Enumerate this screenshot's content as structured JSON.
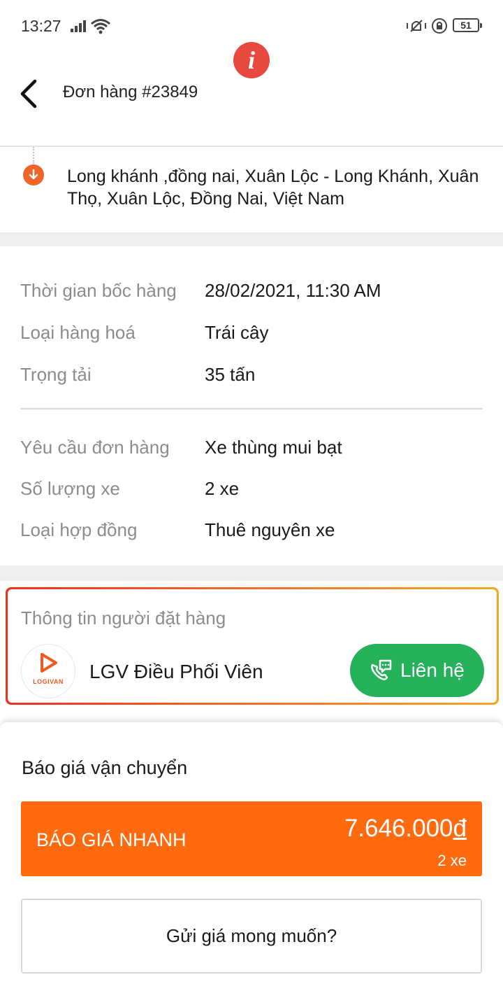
{
  "status_bar": {
    "time": "13:27",
    "battery": "51"
  },
  "header": {
    "title": "Đơn hàng #23849"
  },
  "route": {
    "dropoff_address": "Long khánh ,đồng nai, Xuân Lộc - Long Khánh, Xuân Thọ, Xuân Lộc, Đồng Nai, Việt Nam"
  },
  "details": [
    {
      "label": "Thời gian bốc hàng",
      "value": "28/02/2021, 11:30 AM"
    },
    {
      "label": "Loại hàng hoá",
      "value": "Trái cây"
    },
    {
      "label": "Trọng tải",
      "value": "35 tấn"
    }
  ],
  "requirements": [
    {
      "label": "Yêu cầu đơn hàng",
      "value": "Xe thùng mui bạt"
    },
    {
      "label": "Số lượng xe",
      "value": "2 xe"
    },
    {
      "label": "Loại hợp đồng",
      "value": "Thuê nguyên xe"
    }
  ],
  "booker": {
    "heading": "Thông tin người đặt hàng",
    "avatar_text": "LOGIVAN",
    "name": "LGV Điều Phối Viên",
    "contact_label": "Liên hệ"
  },
  "quote": {
    "title": "Báo giá vận chuyển",
    "fast_label": "BÁO GIÁ NHANH",
    "fast_price": "7.646.000",
    "currency": "đ",
    "fast_count": "2 xe",
    "desired_label": "Gửi giá mong muốn?"
  },
  "colors": {
    "accent": "#ff6a0e",
    "contact": "#25b05a",
    "info": "#e8493f"
  }
}
